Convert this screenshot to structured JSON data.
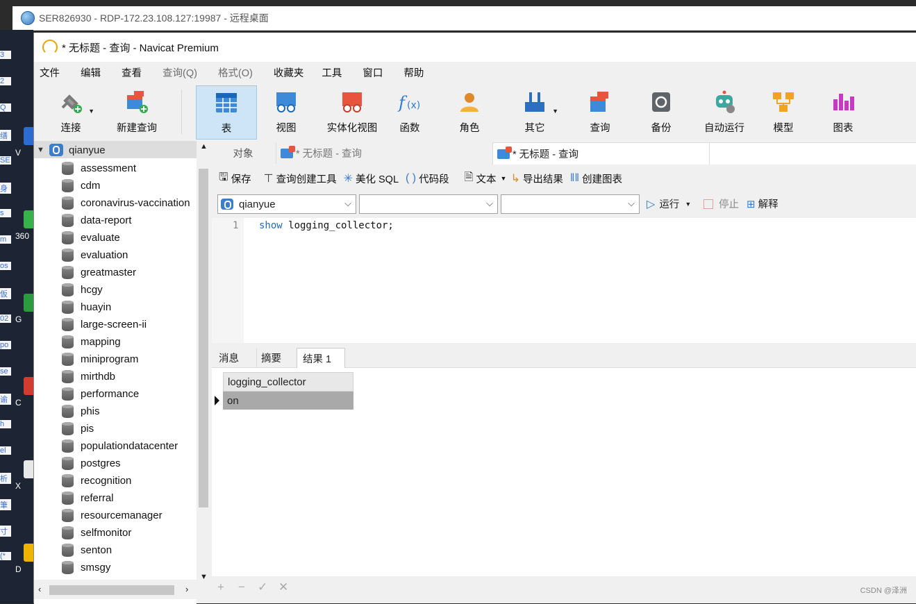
{
  "rdp": {
    "title": "SER826930 - RDP-172.23.108.127:19987 - 远程桌面"
  },
  "desktop": {
    "fragments": [
      "3",
      "2",
      "Q",
      "缮",
      "SE",
      "身",
      "s",
      "m",
      "os",
      "仮",
      "02",
      "po",
      "se",
      "谕",
      "h",
      "el",
      "析",
      "筆",
      "寸",
      "(*"
    ],
    "labels": [
      "V",
      "360",
      "G",
      "C",
      "X",
      "D"
    ]
  },
  "window": {
    "title": "* 无标题 - 查询 - Navicat Premium"
  },
  "menu": [
    "文件",
    "编辑",
    "查看",
    "查询(Q)",
    "格式(O)",
    "收藏夹",
    "工具",
    "窗口",
    "帮助"
  ],
  "toolbar": {
    "connect": "连接",
    "new_query": "新建查询",
    "table": "表",
    "view": "视图",
    "mat_view": "实体化视图",
    "function": "函数",
    "role": "角色",
    "other": "其它",
    "query": "查询",
    "backup": "备份",
    "automation": "自动运行",
    "model": "模型",
    "chart": "图表"
  },
  "tree": {
    "root": "qianyue",
    "databases": [
      "assessment",
      "cdm",
      "coronavirus-vaccination",
      "data-report",
      "evaluate",
      "evaluation",
      "greatmaster",
      "hcgy",
      "huayin",
      "large-screen-ii",
      "mapping",
      "miniprogram",
      "mirthdb",
      "performance",
      "phis",
      "pis",
      "populationdatacenter",
      "postgres",
      "recognition",
      "referral",
      "resourcemanager",
      "selfmonitor",
      "senton",
      "smsgy"
    ]
  },
  "tabs": {
    "objects": "对象",
    "tab1": "* 无标题 - 查询",
    "tab2": "* 无标题 - 查询"
  },
  "query_tools": {
    "save": "保存",
    "builder": "查询创建工具",
    "beautify": "美化 SQL",
    "snippet": "代码段",
    "text": "文本",
    "export": "导出结果",
    "create_chart": "创建图表"
  },
  "selects": {
    "connection": "qianyue",
    "database": "",
    "schema": "",
    "run": "运行",
    "stop": "停止",
    "explain": "解释"
  },
  "editor": {
    "line": "1",
    "keyword": "show",
    "rest": " logging_collector;"
  },
  "result_tabs": [
    "消息",
    "摘要",
    "结果 1"
  ],
  "result": {
    "column": "logging_collector",
    "value": "on"
  },
  "grid_tools": [
    "+",
    "−",
    "✓",
    "✕"
  ],
  "watermark": "CSDN @泽洲"
}
